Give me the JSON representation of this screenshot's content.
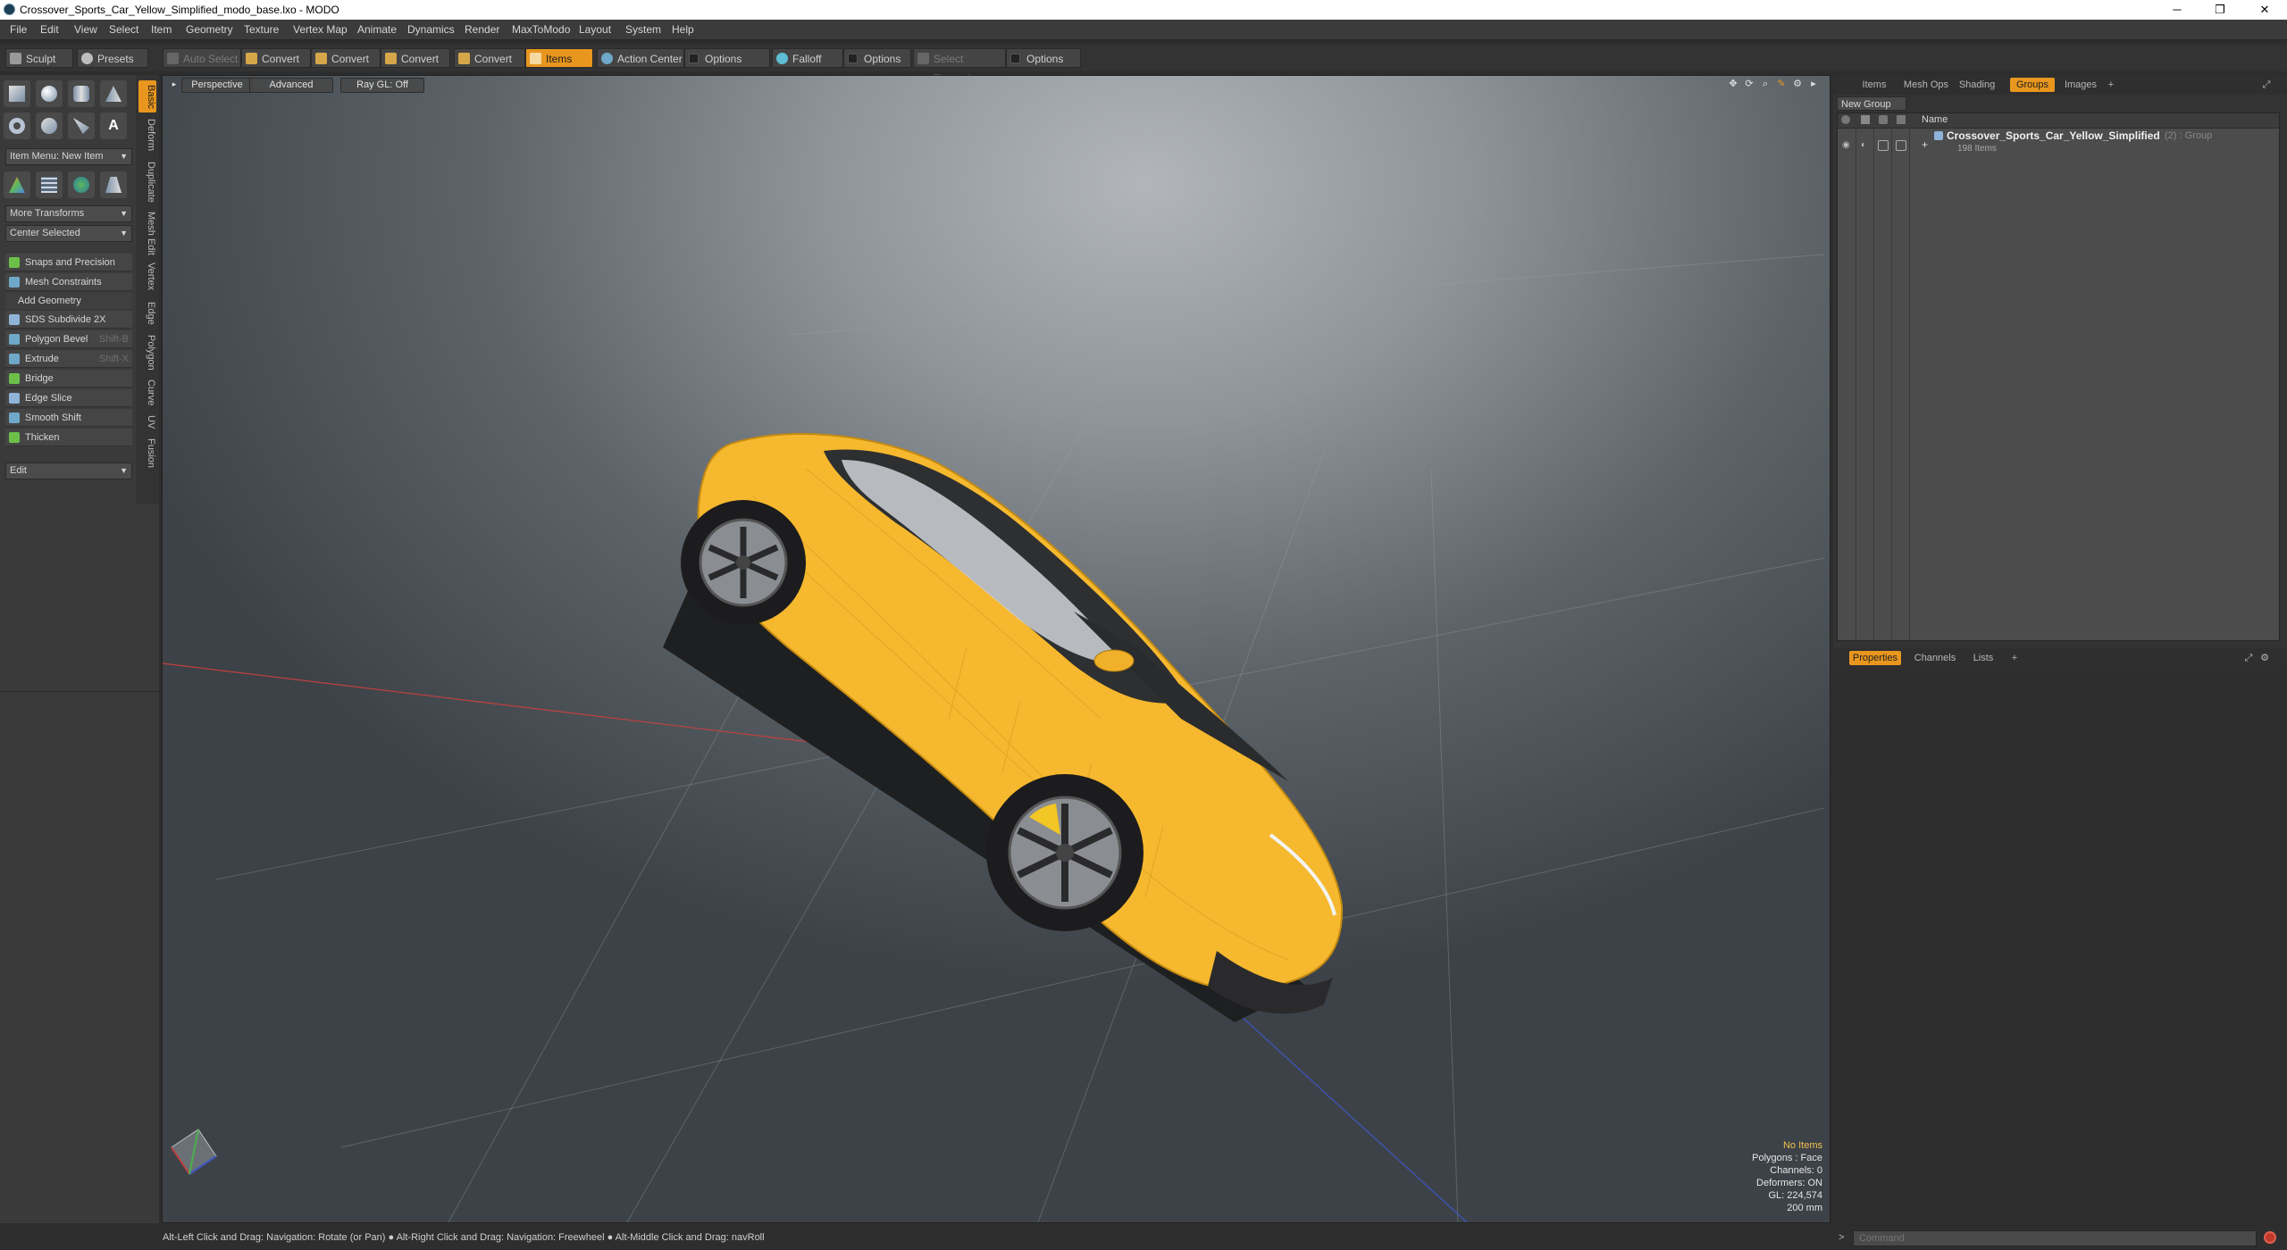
{
  "window": {
    "title": "Crossover_Sports_Car_Yellow_Simplified_modo_base.lxo - MODO",
    "minimize": "─",
    "restore": "❐",
    "close": "✕"
  },
  "menu": [
    "File",
    "Edit",
    "View",
    "Select",
    "Item",
    "Geometry",
    "Texture",
    "Vertex Map",
    "Animate",
    "Dynamics",
    "Render",
    "MaxToModo",
    "Layout",
    "System",
    "Help"
  ],
  "toolbar": {
    "sculpt": "Sculpt",
    "presets": "Presets",
    "auto_select": "Auto Select",
    "convert": "Convert",
    "items": "Items",
    "action_center": "Action Center",
    "options": "Options",
    "falloff": "Falloff",
    "select_through": "Select Through"
  },
  "left": {
    "tabs": [
      "Basic",
      "Deform",
      "Duplicate",
      "Mesh Edit",
      "Vertex",
      "Edge",
      "Polygon",
      "Curve",
      "UV",
      "Fusion"
    ],
    "item_menu": "Item Menu: New Item",
    "more_transforms": "More Transforms",
    "center_selected": "Center Selected",
    "snaps": "Snaps and Precision",
    "mesh_constraints": "Mesh Constraints",
    "add_geometry": "Add Geometry",
    "tools": [
      {
        "label": "SDS Subdivide 2X",
        "shortcut": ""
      },
      {
        "label": "Polygon Bevel",
        "shortcut": "Shift-B"
      },
      {
        "label": "Extrude",
        "shortcut": "Shift-X"
      },
      {
        "label": "Bridge",
        "shortcut": ""
      },
      {
        "label": "Edge Slice",
        "shortcut": ""
      },
      {
        "label": "Smooth Shift",
        "shortcut": ""
      },
      {
        "label": "Thicken",
        "shortcut": ""
      }
    ],
    "edit": "Edit"
  },
  "viewport": {
    "perspective": "Perspective",
    "advanced": "Advanced",
    "ray_gl": "Ray GL: Off",
    "info": [
      "No Items",
      "Polygons : Face",
      "Channels: 0",
      "Deformers: ON",
      "GL: 224,574",
      "200 mm"
    ]
  },
  "right": {
    "tabs": [
      "Items",
      "Mesh Ops",
      "Shading",
      "Groups",
      "Images",
      "+"
    ],
    "new_group": "New Group",
    "name_col": "Name",
    "group_name": "Crossover_Sports_Car_Yellow_Simplified",
    "group_meta": "(2) : Group",
    "group_items": "198 Items",
    "bottom_tabs": [
      "Properties",
      "Channels",
      "Lists",
      "+"
    ]
  },
  "status": {
    "hint": "Alt-Left Click and Drag: Navigation: Rotate (or Pan) ● Alt-Right Click and Drag: Navigation: Freewheel ● Alt-Middle Click and Drag: navRoll",
    "command_placeholder": "Command"
  },
  "colors": {
    "accent": "#e8961e",
    "car_body": "#f5b82e"
  }
}
